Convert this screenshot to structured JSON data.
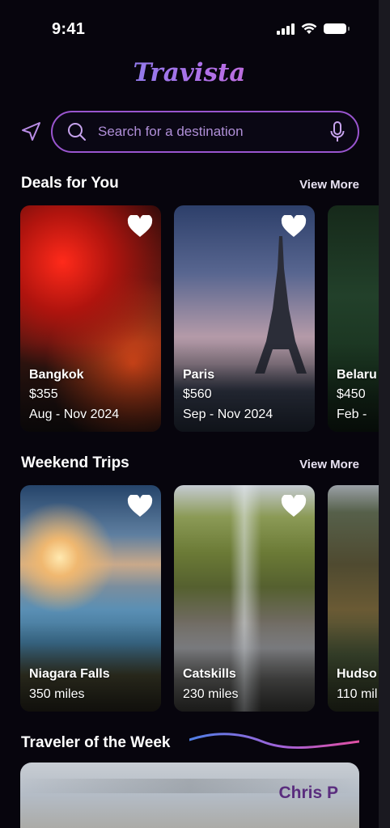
{
  "status_bar": {
    "time": "9:41"
  },
  "app": {
    "logo": "Travista"
  },
  "search": {
    "placeholder": "Search for a destination"
  },
  "deals": {
    "title": "Deals for You",
    "view_more": "View More",
    "cards": [
      {
        "name": "Bangkok",
        "price": "$355",
        "dates": "Aug - Nov 2024"
      },
      {
        "name": "Paris",
        "price": "$560",
        "dates": "Sep - Nov 2024"
      },
      {
        "name": "Belaru",
        "price": "$450",
        "dates": "Feb -"
      }
    ]
  },
  "weekend": {
    "title": "Weekend Trips",
    "view_more": "View More",
    "cards": [
      {
        "name": "Niagara Falls",
        "distance": "350 miles"
      },
      {
        "name": "Catskills",
        "distance": "230 miles"
      },
      {
        "name": "Hudso",
        "distance": "110 mil"
      }
    ]
  },
  "traveler": {
    "title": "Traveler of the Week",
    "name": "Chris P"
  },
  "colors": {
    "background": "#07050d",
    "accent": "#9a55cf",
    "logo_gradient": [
      "#5b8cf0",
      "#b070e8",
      "#e35fb0"
    ]
  },
  "icons": [
    "location-arrow-icon",
    "search-icon",
    "microphone-icon",
    "heart-icon",
    "signal-icon",
    "wifi-icon",
    "battery-icon"
  ]
}
